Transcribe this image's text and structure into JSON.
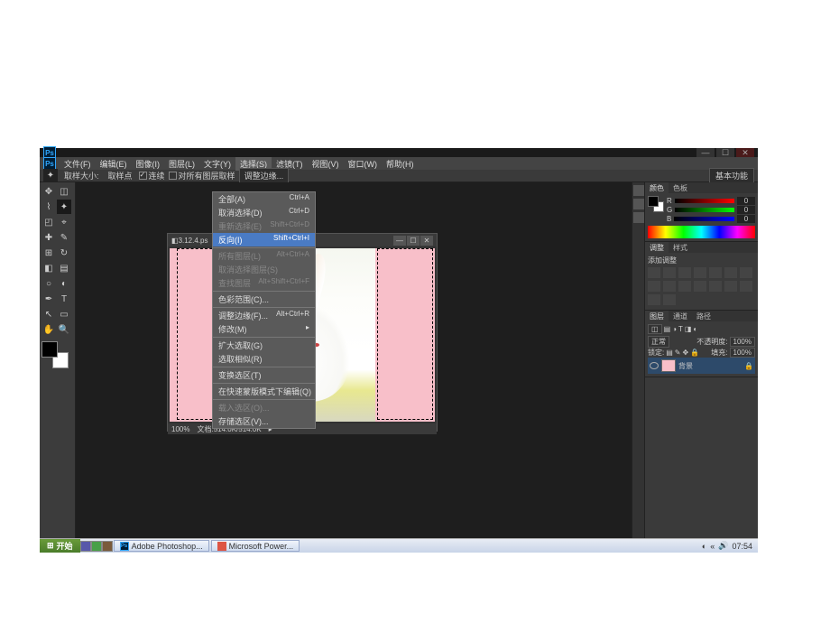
{
  "menubar": {
    "items": [
      "文件(F)",
      "编辑(E)",
      "图像(I)",
      "图层(L)",
      "文字(Y)",
      "选择(S)",
      "滤镜(T)",
      "视图(V)",
      "窗口(W)",
      "帮助(H)"
    ]
  },
  "optionsbar": {
    "tool_hint": "取样大小:",
    "sample": "取样点",
    "contiguous_label": "连续",
    "all_layers_label": "对所有图层取样",
    "refine_label": "调整边缘...",
    "essential": "基本功能"
  },
  "dropdown": {
    "items": [
      {
        "label": "全部(A)",
        "shortcut": "Ctrl+A",
        "disabled": false
      },
      {
        "label": "取消选择(D)",
        "shortcut": "Ctrl+D",
        "disabled": false
      },
      {
        "label": "重新选择(E)",
        "shortcut": "Shift+Ctrl+D",
        "disabled": true
      },
      {
        "label": "反向(I)",
        "shortcut": "Shift+Ctrl+I",
        "disabled": false,
        "highlight": true
      },
      {
        "sep": true
      },
      {
        "label": "所有图层(L)",
        "shortcut": "Alt+Ctrl+A",
        "disabled": true
      },
      {
        "label": "取消选择图层(S)",
        "shortcut": "",
        "disabled": true
      },
      {
        "label": "查找图层",
        "shortcut": "Alt+Shift+Ctrl+F",
        "disabled": true
      },
      {
        "sep": true
      },
      {
        "label": "色彩范围(C)...",
        "shortcut": "",
        "disabled": false
      },
      {
        "sep": true
      },
      {
        "label": "调整边缘(F)...",
        "shortcut": "Alt+Ctrl+R",
        "disabled": false
      },
      {
        "label": "修改(M)",
        "shortcut": "▸",
        "disabled": false
      },
      {
        "sep": true
      },
      {
        "label": "扩大选取(G)",
        "shortcut": "",
        "disabled": false
      },
      {
        "label": "选取相似(R)",
        "shortcut": "",
        "disabled": false
      },
      {
        "sep": true
      },
      {
        "label": "变换选区(T)",
        "shortcut": "",
        "disabled": false
      },
      {
        "sep": true
      },
      {
        "label": "在快速蒙版模式下编辑(Q)",
        "shortcut": "",
        "disabled": false
      },
      {
        "sep": true
      },
      {
        "label": "载入选区(O)...",
        "shortcut": "",
        "disabled": true
      },
      {
        "label": "存储选区(V)...",
        "shortcut": "",
        "disabled": false
      }
    ]
  },
  "doc": {
    "title": "3.12.4.ps",
    "zoom": "100%",
    "status": "文档:514.0K/514.0K"
  },
  "panels": {
    "color_tab": "颜色",
    "swatches_tab": "色板",
    "r_label": "R",
    "g_label": "G",
    "b_label": "B",
    "r_val": "0",
    "g_val": "0",
    "b_val": "0",
    "adjust_tab": "调整",
    "styles_tab": "样式",
    "add_adjust": "添加调整",
    "layers_tab": "图层",
    "channels_tab": "通道",
    "paths_tab": "路径",
    "blend": "正常",
    "opacity_label": "不透明度:",
    "opacity_val": "100%",
    "lock_label": "锁定:",
    "fill_label": "填充:",
    "fill_val": "100%",
    "layer_name": "背景"
  },
  "taskbar": {
    "start": "开始",
    "task1": "Adobe Photoshop...",
    "task2": "Microsoft Power...",
    "time": "07:54"
  }
}
